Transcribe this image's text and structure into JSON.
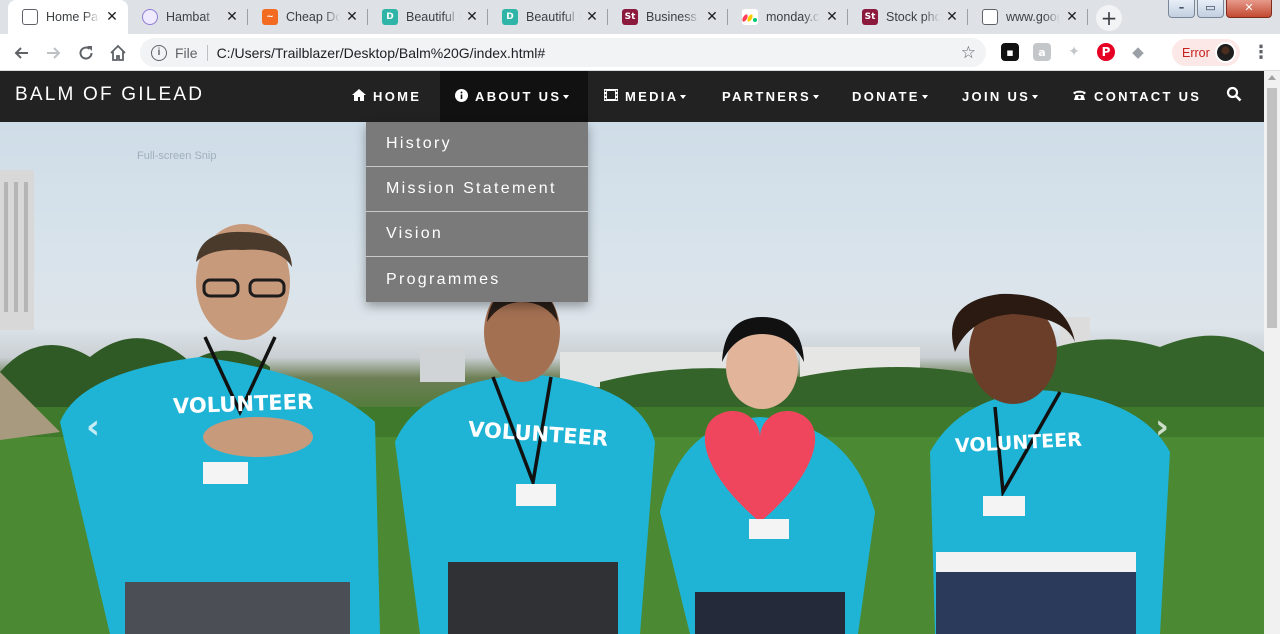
{
  "browser": {
    "tabs": [
      {
        "title": "Home Page",
        "favicon": "page-icon",
        "color": "#ffffff",
        "active": true
      },
      {
        "title": "Hambat",
        "favicon": "hambat-icon",
        "color": "#8f7bd6"
      },
      {
        "title": "Cheap Domains",
        "favicon": "cheap-domains-icon",
        "color": "#f26b21"
      },
      {
        "title": "Beautiful Dashboards",
        "favicon": "d-icon",
        "color": "#2fb5a7"
      },
      {
        "title": "Beautiful Dashboards",
        "favicon": "d-icon",
        "color": "#2fb5a7"
      },
      {
        "title": "Business Plan",
        "favicon": "st-icon",
        "color": "#8b1a3d"
      },
      {
        "title": "monday.com",
        "favicon": "monday-icon",
        "color": "#ff3d57"
      },
      {
        "title": "Stock photos",
        "favicon": "st-icon",
        "color": "#8b1a3d"
      },
      {
        "title": "www.google.com",
        "favicon": "page-icon",
        "color": "#ffffff"
      }
    ],
    "new_tab_symbol": "+",
    "window_controls": {
      "minimize": "–",
      "maximize": "▭",
      "close": "✕"
    },
    "address": {
      "scheme": "File",
      "url": "C:/Users/Trailblazer/Desktop/Balm%20G/index.html#"
    },
    "profile_status": "Error"
  },
  "site": {
    "brand": "BALM OF GILEAD",
    "nav": [
      {
        "label": "HOME",
        "icon": "home-icon",
        "dropdown": false
      },
      {
        "label": "ABOUT US",
        "icon": "info-icon",
        "dropdown": true,
        "active": true
      },
      {
        "label": "MEDIA",
        "icon": "film-icon",
        "dropdown": true
      },
      {
        "label": "PARTNERS",
        "icon": "",
        "dropdown": true
      },
      {
        "label": "DONATE",
        "icon": "",
        "dropdown": true
      },
      {
        "label": "JOIN US",
        "icon": "",
        "dropdown": true
      },
      {
        "label": "CONTACT US",
        "icon": "phone-icon",
        "dropdown": false
      }
    ],
    "about_dropdown": [
      "History",
      "Mission Statement",
      "Vision",
      "Programmes"
    ],
    "hero": {
      "overlay_text": "Full-screen Snip",
      "shirt_text": "VOLUNTEER",
      "prev_symbol": "‹",
      "next_symbol": "›"
    }
  }
}
